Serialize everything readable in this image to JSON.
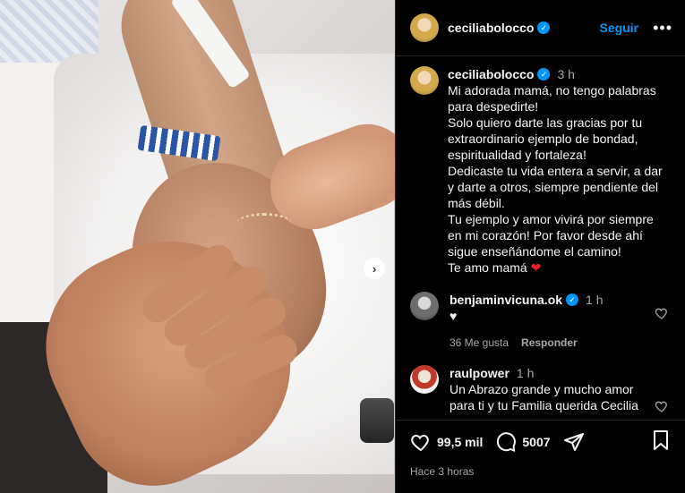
{
  "post": {
    "author": "ceciliabolocco",
    "follow_label": "Seguir",
    "more_label": "•••",
    "carousel_next": "›"
  },
  "caption": {
    "author": "ceciliabolocco",
    "time": "3 h",
    "lines": [
      "Mi adorada mamá, no tengo palabras para despedirte!",
      "Solo quiero darte las gracias por tu extraordinario ejemplo de bondad, espiritualidad y fortaleza!",
      "Dedicaste tu vida entera a servir, a dar y darte a otros, siempre pendiente del más débil.",
      "Tu ejemplo y amor vivirá por siempre en mi corazón! Por favor desde ahí sigue enseñándome el camino!",
      "Te amo mamá"
    ],
    "emoji": "❤"
  },
  "comments": [
    {
      "author": "benjaminvicuna.ok",
      "time": "1 h",
      "text": "♥",
      "likes": "36 Me gusta",
      "reply_label": "Responder"
    },
    {
      "author": "raulpower",
      "time": "1 h",
      "text": "Un Abrazo grande y mucho amor para ti y tu Familia querida Cecilia"
    }
  ],
  "footer": {
    "likes_count": "99,5 mil",
    "comments_count": "5007",
    "timestamp": "Hace 3 horas"
  },
  "colors": {
    "accent": "#0095f6",
    "background": "#000000",
    "secondary_text": "#a8a8a8",
    "heart": "#ed1c24"
  },
  "icons": [
    "chevron-right-icon",
    "verified-badge-icon",
    "more-icon",
    "heart-outline-icon",
    "comment-icon",
    "share-icon",
    "bookmark-icon"
  ]
}
